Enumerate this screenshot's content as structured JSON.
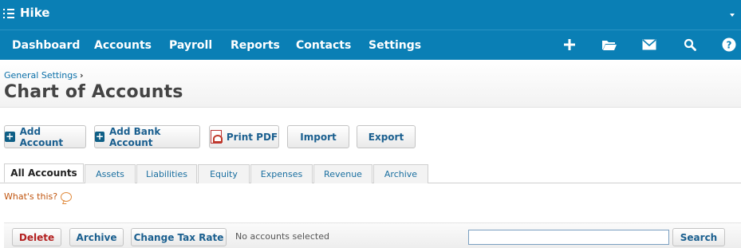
{
  "topbar": {
    "org_name": "Hike",
    "accent": "#0a7fb5"
  },
  "nav": {
    "items": [
      "Dashboard",
      "Accounts",
      "Payroll",
      "Reports",
      "Contacts",
      "Settings"
    ],
    "icons": [
      "plus-icon",
      "folder-icon",
      "mail-icon",
      "search-icon",
      "help-icon"
    ]
  },
  "header": {
    "breadcrumb": "General Settings",
    "breadcrumb_sep": "›",
    "title": "Chart of Accounts"
  },
  "toolbar": {
    "add_account": "Add Account",
    "add_bank_account": "Add Bank Account",
    "print_pdf": "Print PDF",
    "import": "Import",
    "export": "Export"
  },
  "tabs": [
    {
      "label": "All Accounts",
      "active": true
    },
    {
      "label": "Assets"
    },
    {
      "label": "Liabilities"
    },
    {
      "label": "Equity"
    },
    {
      "label": "Expenses"
    },
    {
      "label": "Revenue"
    },
    {
      "label": "Archive"
    }
  ],
  "help": {
    "whats_this": "What's this?"
  },
  "actions": {
    "delete": "Delete",
    "archive": "Archive",
    "change_tax_rate": "Change Tax Rate",
    "status": "No accounts selected",
    "search_placeholder": "",
    "search_button": "Search"
  }
}
